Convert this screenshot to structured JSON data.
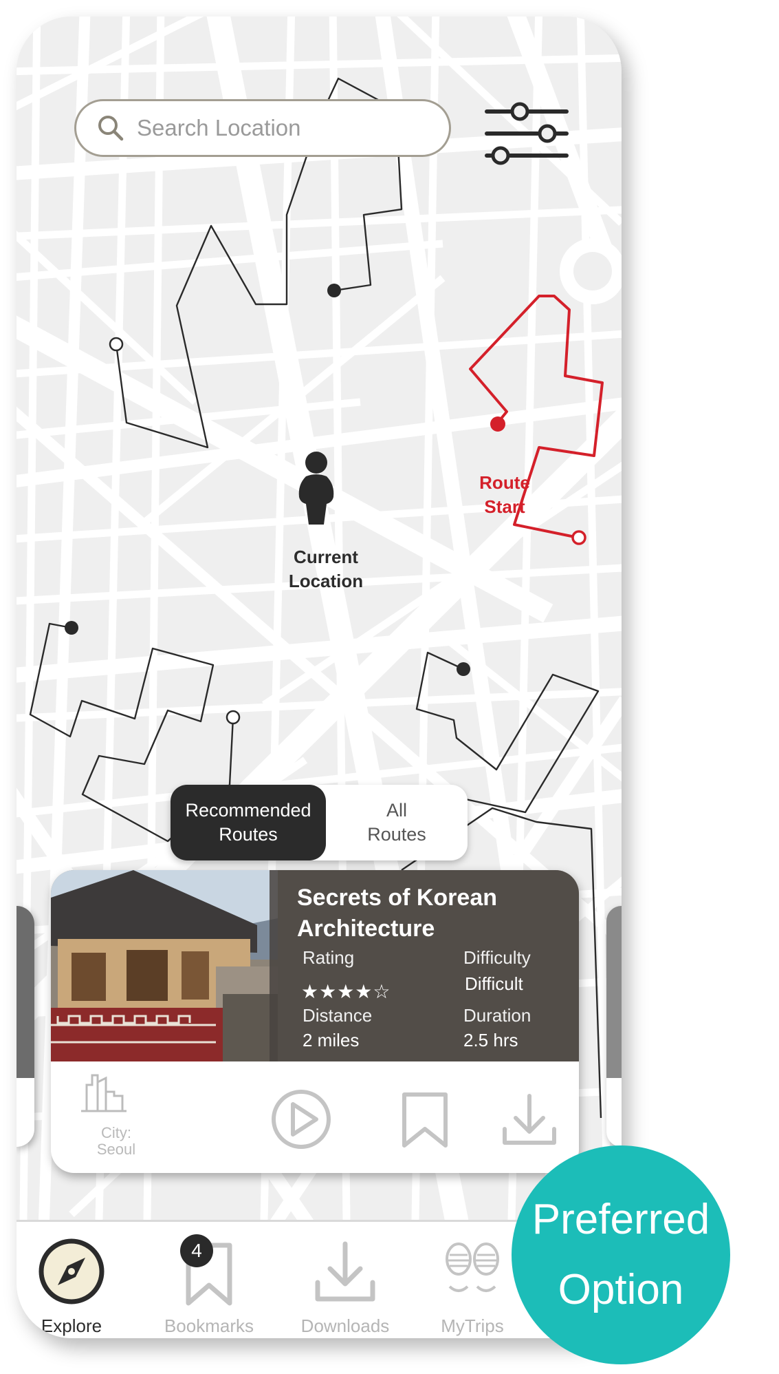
{
  "search": {
    "placeholder": "Search Location"
  },
  "map": {
    "current_location_label": [
      "Current",
      "Location"
    ],
    "route_start_label": [
      "Route",
      "Start"
    ],
    "route_accent_color": "#d4202a"
  },
  "route_toggle": {
    "recommended": [
      "Recommended",
      "Routes"
    ],
    "all": [
      "All",
      "Routes"
    ],
    "selected": "Recommended Routes"
  },
  "route_card": {
    "title": [
      "Secrets of Korean",
      "Architecture"
    ],
    "rating_label": "Rating",
    "rating_value": 4,
    "rating_max": 5,
    "difficulty_label": "Difficulty",
    "difficulty_value": "Difficult",
    "distance_label": "Distance",
    "distance_value": "2 miles",
    "duration_label": "Duration",
    "duration_value": "2.5 hrs",
    "city_label": [
      "City:",
      "Seoul"
    ],
    "icons": [
      "city-icon",
      "play-icon",
      "bookmark-icon",
      "download-icon"
    ]
  },
  "nav": {
    "items": [
      {
        "label": "Explore",
        "icon": "compass-icon",
        "active": true
      },
      {
        "label": "Bookmarks",
        "icon": "bookmark-icon",
        "badge": "4"
      },
      {
        "label": "Downloads",
        "icon": "download-icon"
      },
      {
        "label": "MyTrips",
        "icon": "footprints-icon"
      }
    ]
  },
  "preferred_badge": [
    "Preferred",
    "Option"
  ]
}
